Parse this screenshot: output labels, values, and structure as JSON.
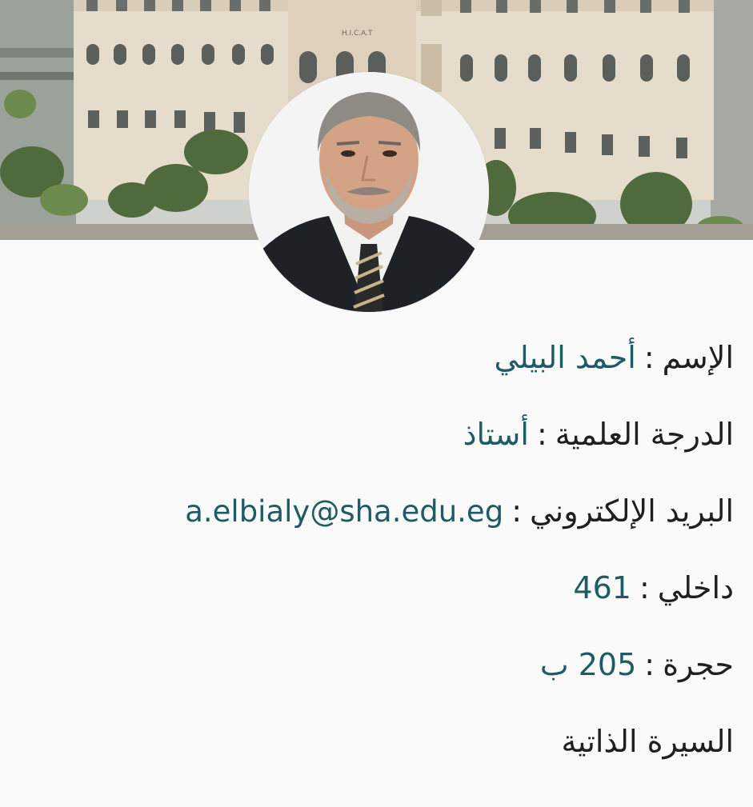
{
  "banner": {
    "building_sign": "H.I.C.A.T"
  },
  "profile": {
    "name_label": "الإسم",
    "name_value": "أحمد البيلي",
    "degree_label": "الدرجة العلمية",
    "degree_value": "أستاذ",
    "email_label": "البريد الإلكتروني",
    "email_value": "a.elbialy@sha.edu.eg",
    "ext_label": "داخلي",
    "ext_value": "461",
    "room_label": "حجرة",
    "room_value": "205 ب",
    "cv_label": "السيرة الذاتية",
    "separator": ":"
  },
  "colors": {
    "label": "#1f1f1f",
    "value": "#1e5b63",
    "background": "#fafafa"
  }
}
